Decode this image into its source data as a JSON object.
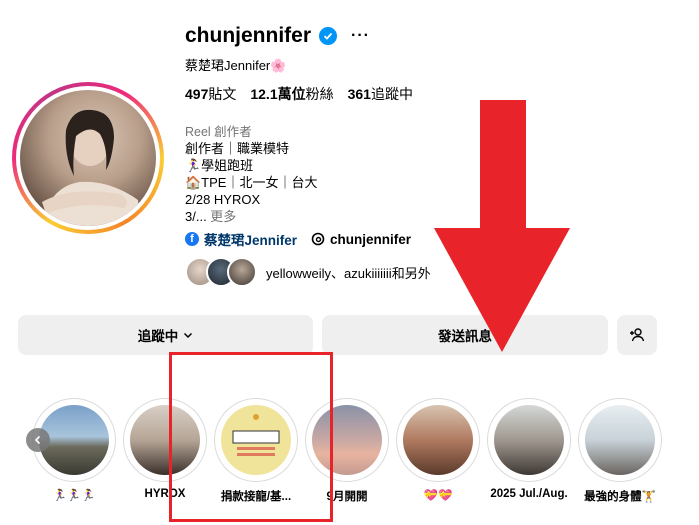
{
  "profile": {
    "username": "chunjennifer",
    "more_label": "···",
    "full_name": "蔡楚珺Jennifer🌸",
    "stats": {
      "posts_count": "497",
      "posts_label": "貼文",
      "followers_count": "12.1萬位",
      "followers_label": "粉絲",
      "following_count": "361",
      "following_label": "追蹤中"
    },
    "category": "Reel 創作者",
    "bio_lines": [
      "創作者｜職業模特",
      "🏃‍♀️學姐跑班",
      "🏠TPE｜北一女｜台大",
      "2/28 HYROX",
      "3/..."
    ],
    "bio_more": " 更多",
    "facebook_link": "蔡楚珺Jennifer",
    "threads_link": "chunjennifer",
    "followed_by": "yellowweily、azukiiiiiii和另外"
  },
  "actions": {
    "following_label": "追蹤中",
    "message_label": "發送訊息"
  },
  "highlights": [
    {
      "label": "🏃‍♀️🏃‍♀️🏃‍♀️"
    },
    {
      "label": "HYROX"
    },
    {
      "label": "捐款接龍/基..."
    },
    {
      "label": "9月開開"
    },
    {
      "label": "💝💝"
    },
    {
      "label": "2025 Jul./Aug."
    },
    {
      "label": "最強的身體🏋️"
    }
  ],
  "colors": {
    "verified": "#0095f6",
    "annotation_red": "#e8232a",
    "link_blue": "#00376b"
  }
}
